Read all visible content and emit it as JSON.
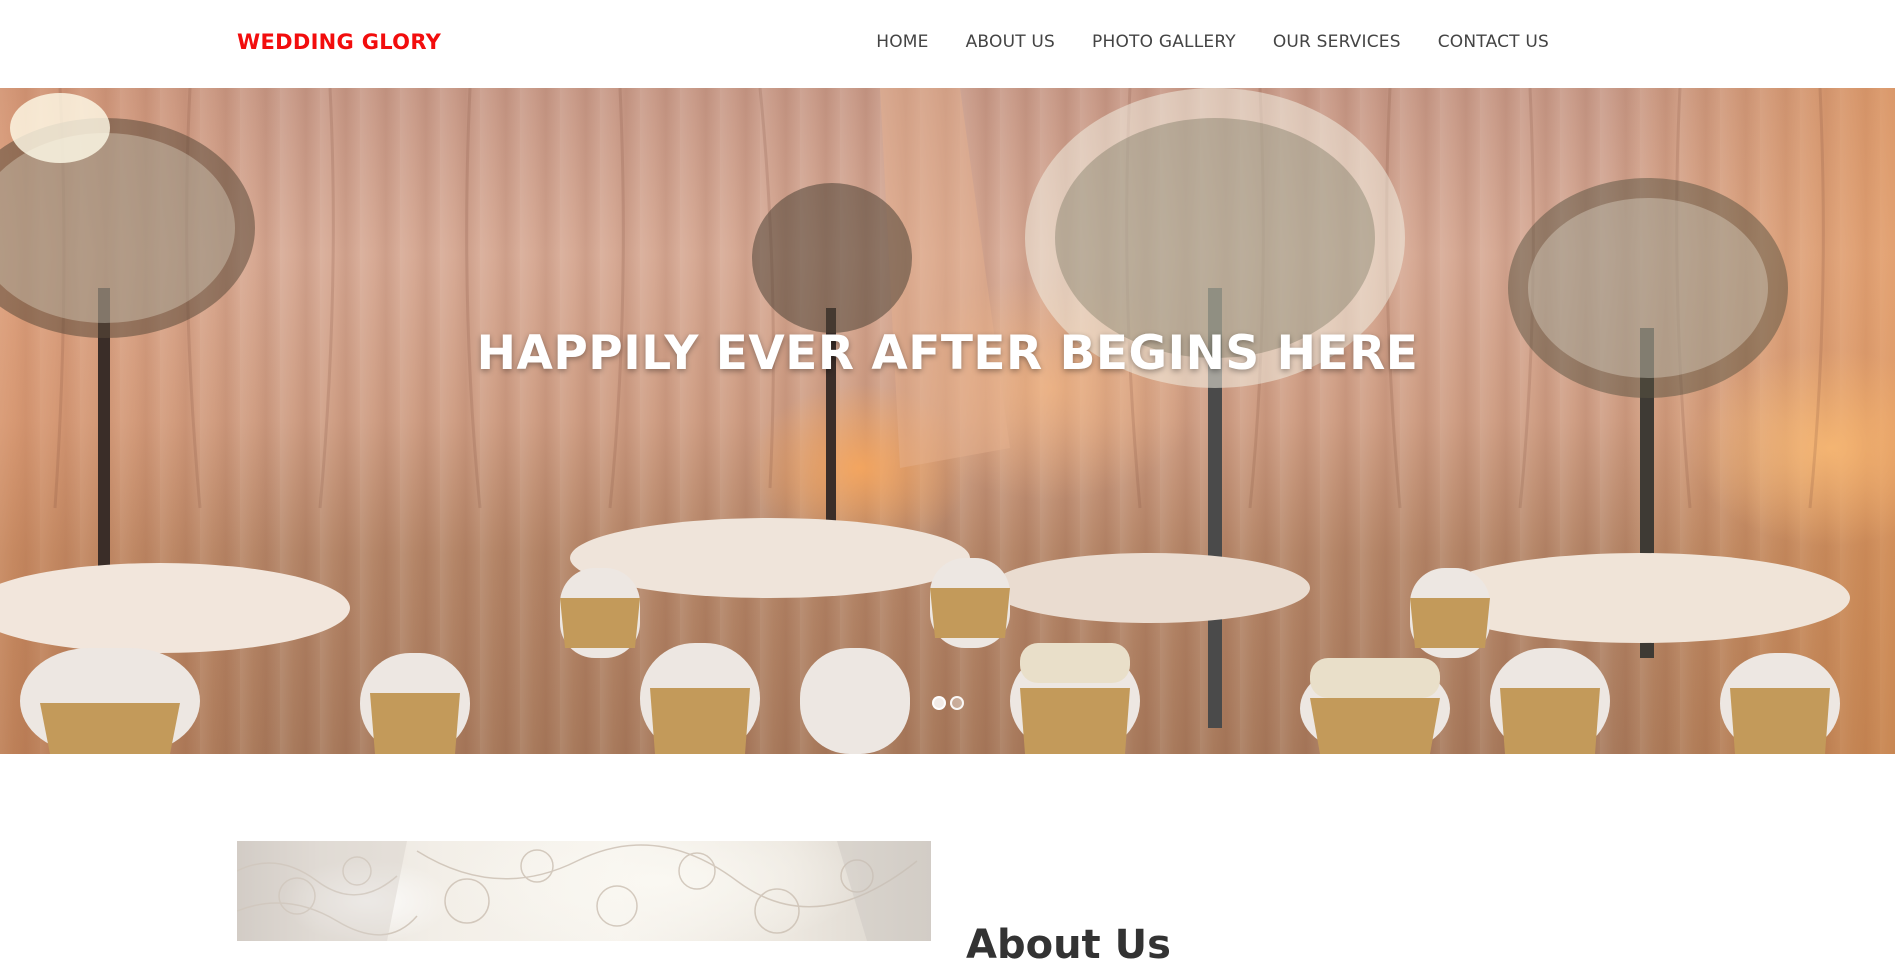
{
  "header": {
    "brand": "WEDDING GLORY",
    "brand_color": "#f20d0d",
    "nav": [
      "HOME",
      "ABOUT US",
      "PHOTO GALLERY",
      "OUR SERVICES",
      "CONTACT US"
    ]
  },
  "hero": {
    "title": "HAPPILY EVER AFTER BEGINS HERE",
    "slide_count": 2,
    "active_slide": 1
  },
  "about": {
    "heading": "About Us"
  }
}
